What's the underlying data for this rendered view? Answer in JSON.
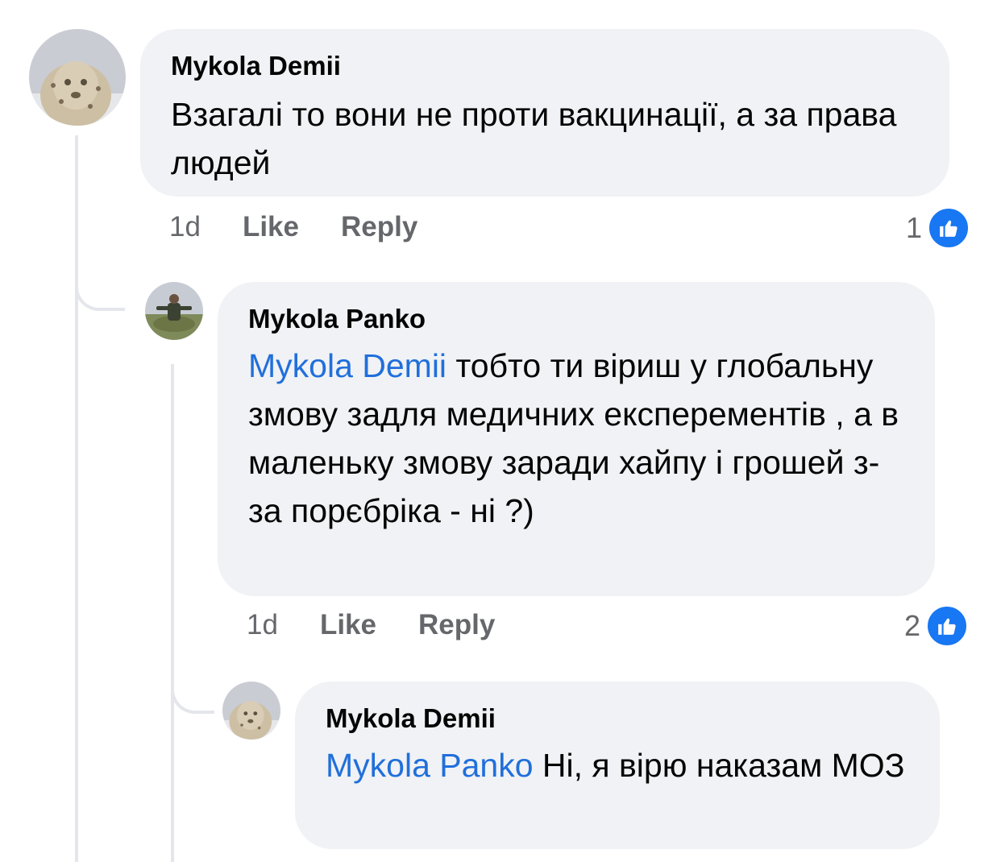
{
  "comments": [
    {
      "author": "Mykola Demii",
      "mention": "",
      "text": "Взагалі то вони не проти вакцинації, а за права людей",
      "time": "1d",
      "like_label": "Like",
      "reply_label": "Reply",
      "reaction_count": "1"
    },
    {
      "author": "Mykola Panko",
      "mention": "Mykola Demii",
      "text": "тобто ти віриш у глобальну змову задля медичних експерементів , а в маленьку змову заради хайпу і грошей з-за порєбріка - ні ?)",
      "time": "1d",
      "like_label": "Like",
      "reply_label": "Reply",
      "reaction_count": "2"
    },
    {
      "author": "Mykola Demii",
      "mention": "Mykola Panko",
      "text": "Ні, я вірю наказам МОЗ"
    }
  ],
  "colors": {
    "bubble": "#f0f2f5",
    "mention": "#216fdb",
    "like": "#1877f2",
    "meta": "#65676b"
  },
  "icons": {
    "avatar_1": "snow-leopard-avatar",
    "avatar_2": "person-sitting-avatar",
    "reaction": "thumbs-up-icon"
  }
}
